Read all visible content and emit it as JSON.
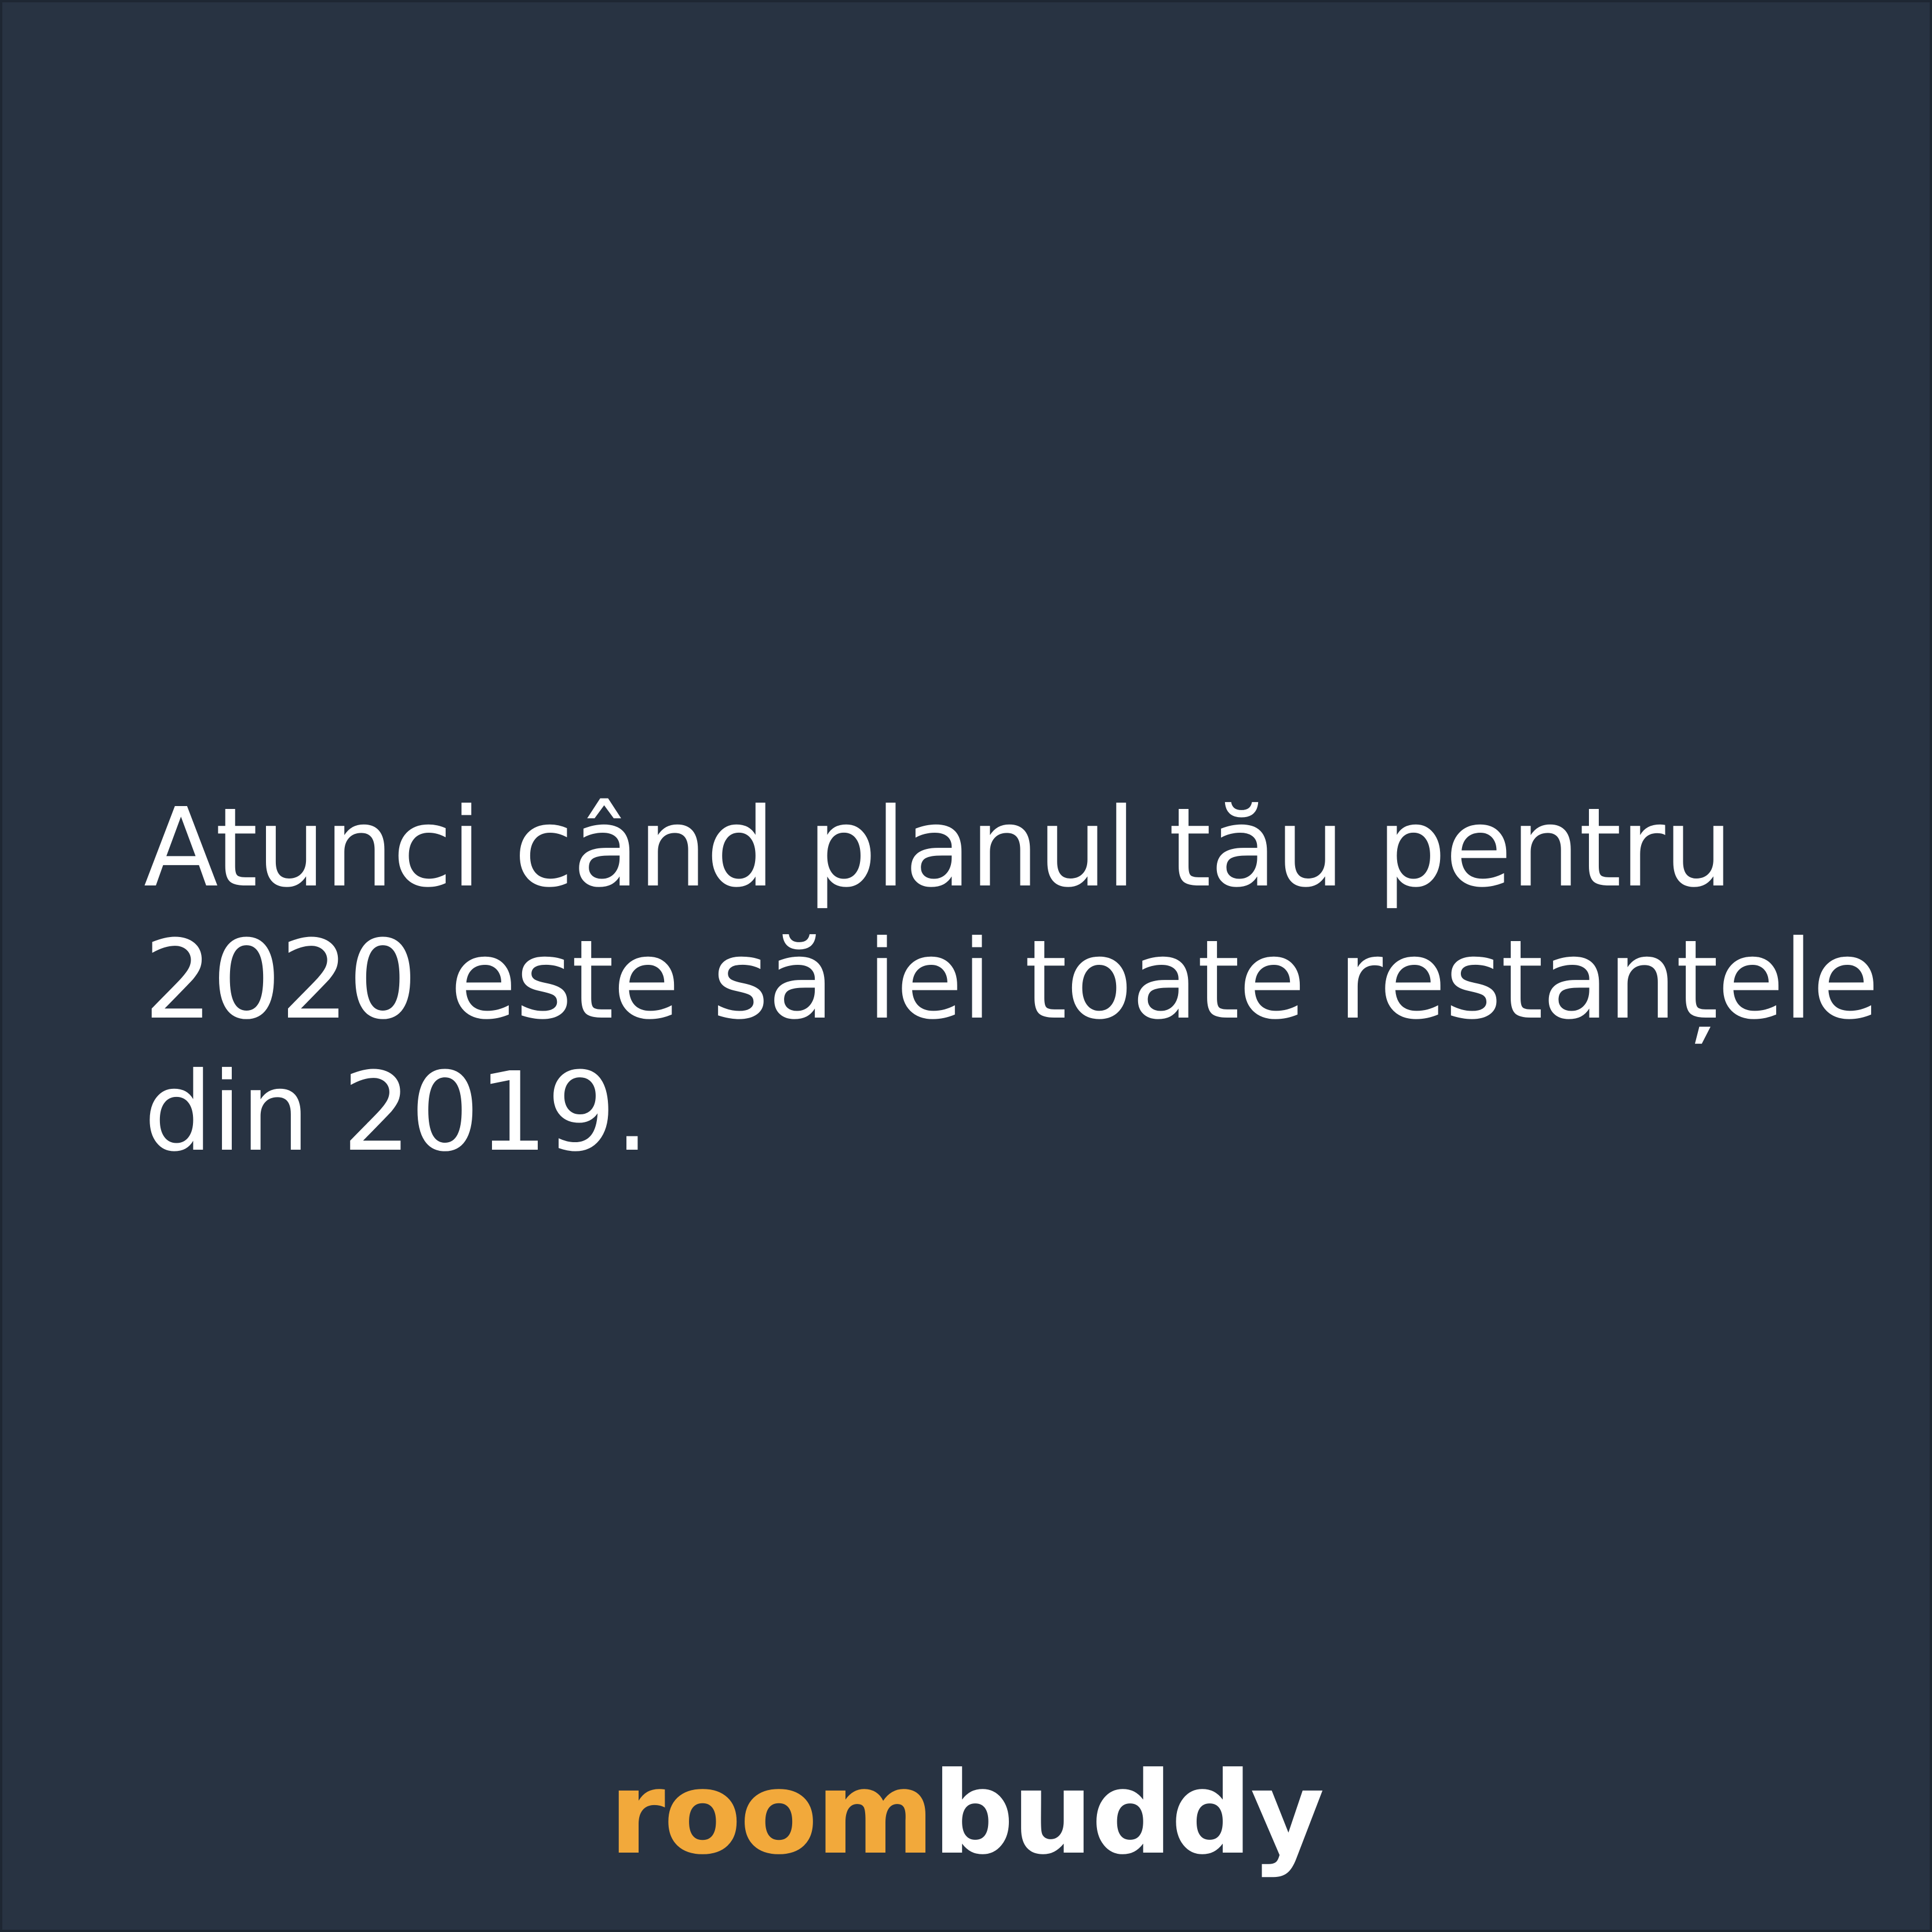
{
  "post": {
    "quote_lines": [
      "Atunci când planul tău pentru",
      "2020 este să iei toate restanțele",
      "din 2019."
    ]
  },
  "brand": {
    "part1": "room",
    "part2": "buddy",
    "accent_color": "#f2a93b",
    "text_color": "#ffffff",
    "background_color": "#283342"
  }
}
